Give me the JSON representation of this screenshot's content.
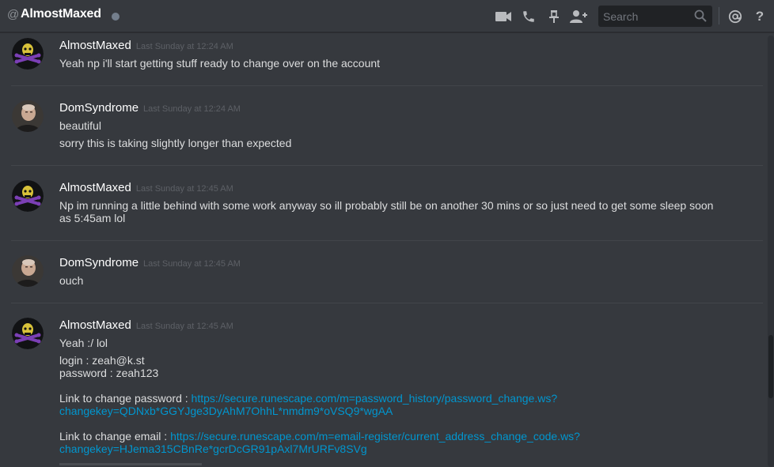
{
  "header": {
    "at_symbol": "@",
    "channel_name": "AlmostMaxed",
    "search_placeholder": "Search",
    "help": "?"
  },
  "messages": [
    {
      "author": "AlmostMaxed",
      "timestamp": "Last Sunday at 12:24 AM",
      "lines": [
        "Yeah np i'll start getting stuff ready to change over on the account"
      ]
    },
    {
      "author": "DomSyndrome",
      "timestamp": "Last Sunday at 12:24 AM",
      "lines": [
        "beautiful",
        "sorry this is taking slightly longer than expected"
      ]
    },
    {
      "author": "AlmostMaxed",
      "timestamp": "Last Sunday at 12:45 AM",
      "lines": [
        "Np im running a little behind with some work anyway so ill probably still be on another 30 mins or so just need to get some sleep soon",
        "as 5:45am lol"
      ]
    },
    {
      "author": "DomSyndrome",
      "timestamp": "Last Sunday at 12:45 AM",
      "lines": [
        "ouch"
      ]
    },
    {
      "author": "AlmostMaxed",
      "timestamp": "Last Sunday at 12:45 AM",
      "lines": [
        "Yeah :/ lol",
        "login : zeah@k.st",
        "password : zeah123",
        "Link to change password : ",
        "Link to change email : "
      ],
      "links": [
        "https://secure.runescape.com/m=password_history/password_change.ws?",
        "changekey=QDNxb*GGYJge3DyAhM7OhhL*nmdm9*oVSQ9*wgAA",
        "https://secure.runescape.com/m=email-register/current_address_change_code.ws?",
        "changekey=HJema315CBnRe*gcrDcGR91pAxl7MrURFv8SVg"
      ]
    }
  ],
  "colors": {
    "background": "#36393e",
    "link": "#0096cf",
    "username": "#ffffff",
    "timestamp": "#5d6066"
  }
}
